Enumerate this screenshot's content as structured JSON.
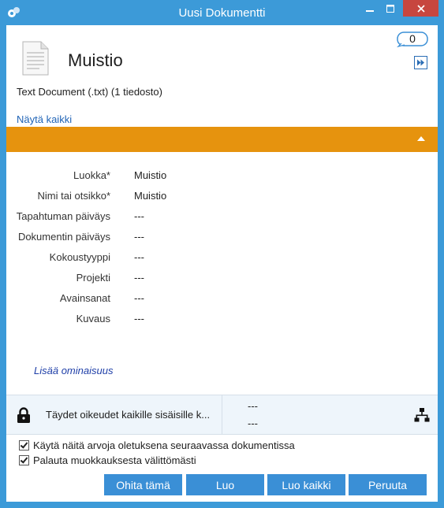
{
  "window": {
    "title": "Uusi Dokumentti",
    "accent_color": "#3c9ad8",
    "close_color": "#c7463f"
  },
  "document": {
    "name": "Muistio",
    "description": "Text Document (.txt) (1 tiedosto)",
    "show_all_label": "Näytä kaikki",
    "badge_count": "0"
  },
  "section_bar_color": "#e6930e",
  "fields": [
    {
      "label": "Luokka*",
      "value": "Muistio"
    },
    {
      "label": "Nimi tai otsikko*",
      "value": "Muistio"
    },
    {
      "label": "Tapahtuman päiväys",
      "value": "---"
    },
    {
      "label": "Dokumentin päiväys",
      "value": "---"
    },
    {
      "label": "Kokoustyyppi",
      "value": "---"
    },
    {
      "label": "Projekti",
      "value": "---"
    },
    {
      "label": "Avainsanat",
      "value": "---"
    },
    {
      "label": "Kuvaus",
      "value": "---"
    }
  ],
  "add_property_label": "Lisää ominaisuus",
  "permissions": {
    "text": "Täydet oikeudet kaikille sisäisille k...",
    "value1": "---",
    "value2": "---"
  },
  "options": [
    {
      "label": "Käytä näitä arvoja oletuksena seuraavassa dokumentissa",
      "checked": true
    },
    {
      "label": "Palauta muokkauksesta välittömästi",
      "checked": true
    }
  ],
  "buttons": {
    "skip": "Ohita tämä",
    "create": "Luo",
    "create_all": "Luo kaikki",
    "cancel": "Peruuta"
  }
}
